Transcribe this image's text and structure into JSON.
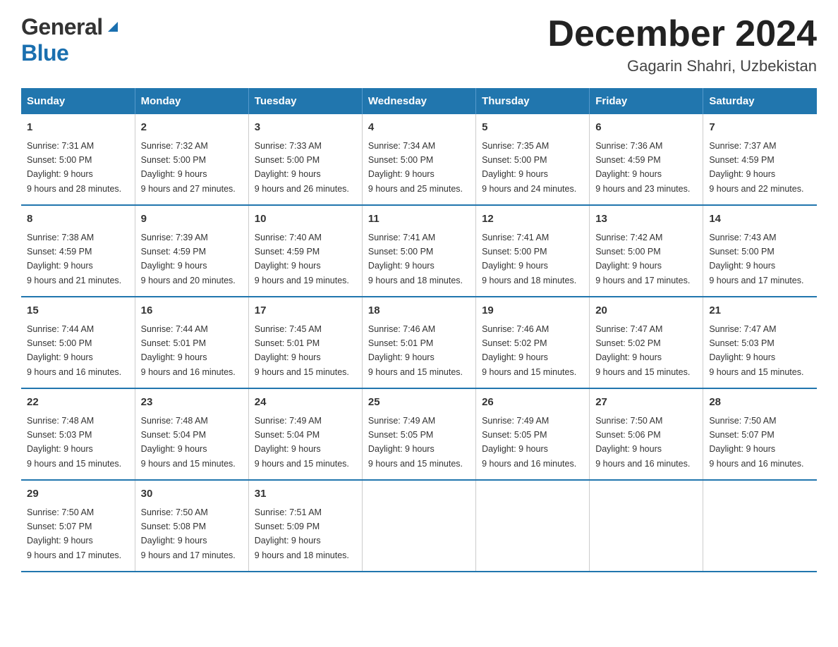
{
  "logo": {
    "general": "General",
    "triangle": "",
    "blue": "Blue"
  },
  "title": {
    "month_year": "December 2024",
    "location": "Gagarin Shahri, Uzbekistan"
  },
  "days_of_week": [
    "Sunday",
    "Monday",
    "Tuesday",
    "Wednesday",
    "Thursday",
    "Friday",
    "Saturday"
  ],
  "weeks": [
    [
      {
        "day": "1",
        "sunrise": "7:31 AM",
        "sunset": "5:00 PM",
        "daylight": "9 hours and 28 minutes."
      },
      {
        "day": "2",
        "sunrise": "7:32 AM",
        "sunset": "5:00 PM",
        "daylight": "9 hours and 27 minutes."
      },
      {
        "day": "3",
        "sunrise": "7:33 AM",
        "sunset": "5:00 PM",
        "daylight": "9 hours and 26 minutes."
      },
      {
        "day": "4",
        "sunrise": "7:34 AM",
        "sunset": "5:00 PM",
        "daylight": "9 hours and 25 minutes."
      },
      {
        "day": "5",
        "sunrise": "7:35 AM",
        "sunset": "5:00 PM",
        "daylight": "9 hours and 24 minutes."
      },
      {
        "day": "6",
        "sunrise": "7:36 AM",
        "sunset": "4:59 PM",
        "daylight": "9 hours and 23 minutes."
      },
      {
        "day": "7",
        "sunrise": "7:37 AM",
        "sunset": "4:59 PM",
        "daylight": "9 hours and 22 minutes."
      }
    ],
    [
      {
        "day": "8",
        "sunrise": "7:38 AM",
        "sunset": "4:59 PM",
        "daylight": "9 hours and 21 minutes."
      },
      {
        "day": "9",
        "sunrise": "7:39 AM",
        "sunset": "4:59 PM",
        "daylight": "9 hours and 20 minutes."
      },
      {
        "day": "10",
        "sunrise": "7:40 AM",
        "sunset": "4:59 PM",
        "daylight": "9 hours and 19 minutes."
      },
      {
        "day": "11",
        "sunrise": "7:41 AM",
        "sunset": "5:00 PM",
        "daylight": "9 hours and 18 minutes."
      },
      {
        "day": "12",
        "sunrise": "7:41 AM",
        "sunset": "5:00 PM",
        "daylight": "9 hours and 18 minutes."
      },
      {
        "day": "13",
        "sunrise": "7:42 AM",
        "sunset": "5:00 PM",
        "daylight": "9 hours and 17 minutes."
      },
      {
        "day": "14",
        "sunrise": "7:43 AM",
        "sunset": "5:00 PM",
        "daylight": "9 hours and 17 minutes."
      }
    ],
    [
      {
        "day": "15",
        "sunrise": "7:44 AM",
        "sunset": "5:00 PM",
        "daylight": "9 hours and 16 minutes."
      },
      {
        "day": "16",
        "sunrise": "7:44 AM",
        "sunset": "5:01 PM",
        "daylight": "9 hours and 16 minutes."
      },
      {
        "day": "17",
        "sunrise": "7:45 AM",
        "sunset": "5:01 PM",
        "daylight": "9 hours and 15 minutes."
      },
      {
        "day": "18",
        "sunrise": "7:46 AM",
        "sunset": "5:01 PM",
        "daylight": "9 hours and 15 minutes."
      },
      {
        "day": "19",
        "sunrise": "7:46 AM",
        "sunset": "5:02 PM",
        "daylight": "9 hours and 15 minutes."
      },
      {
        "day": "20",
        "sunrise": "7:47 AM",
        "sunset": "5:02 PM",
        "daylight": "9 hours and 15 minutes."
      },
      {
        "day": "21",
        "sunrise": "7:47 AM",
        "sunset": "5:03 PM",
        "daylight": "9 hours and 15 minutes."
      }
    ],
    [
      {
        "day": "22",
        "sunrise": "7:48 AM",
        "sunset": "5:03 PM",
        "daylight": "9 hours and 15 minutes."
      },
      {
        "day": "23",
        "sunrise": "7:48 AM",
        "sunset": "5:04 PM",
        "daylight": "9 hours and 15 minutes."
      },
      {
        "day": "24",
        "sunrise": "7:49 AM",
        "sunset": "5:04 PM",
        "daylight": "9 hours and 15 minutes."
      },
      {
        "day": "25",
        "sunrise": "7:49 AM",
        "sunset": "5:05 PM",
        "daylight": "9 hours and 15 minutes."
      },
      {
        "day": "26",
        "sunrise": "7:49 AM",
        "sunset": "5:05 PM",
        "daylight": "9 hours and 16 minutes."
      },
      {
        "day": "27",
        "sunrise": "7:50 AM",
        "sunset": "5:06 PM",
        "daylight": "9 hours and 16 minutes."
      },
      {
        "day": "28",
        "sunrise": "7:50 AM",
        "sunset": "5:07 PM",
        "daylight": "9 hours and 16 minutes."
      }
    ],
    [
      {
        "day": "29",
        "sunrise": "7:50 AM",
        "sunset": "5:07 PM",
        "daylight": "9 hours and 17 minutes."
      },
      {
        "day": "30",
        "sunrise": "7:50 AM",
        "sunset": "5:08 PM",
        "daylight": "9 hours and 17 minutes."
      },
      {
        "day": "31",
        "sunrise": "7:51 AM",
        "sunset": "5:09 PM",
        "daylight": "9 hours and 18 minutes."
      },
      null,
      null,
      null,
      null
    ]
  ]
}
